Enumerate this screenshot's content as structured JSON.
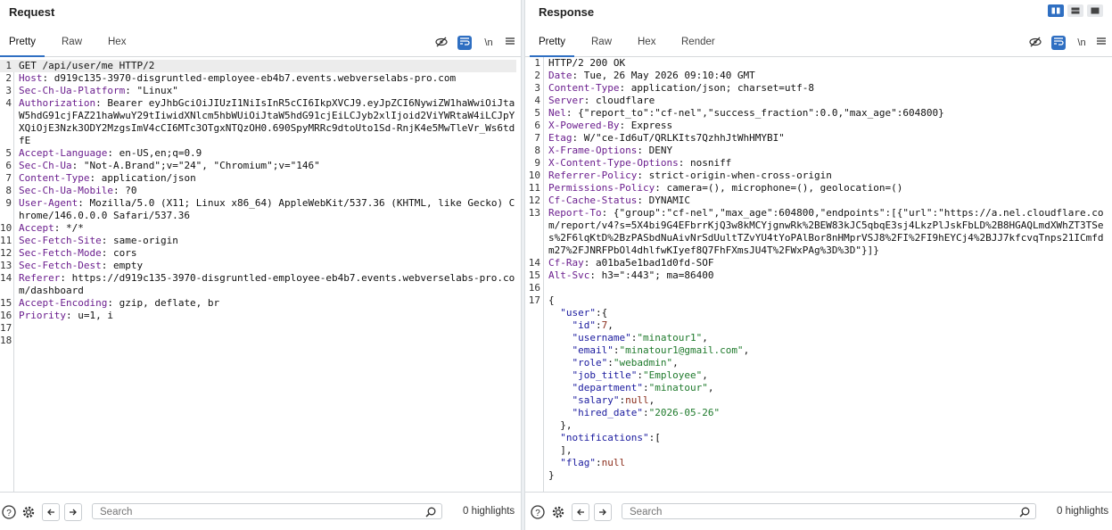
{
  "request": {
    "title": "Request",
    "tabs": [
      "Pretty",
      "Raw",
      "Hex"
    ],
    "active_tab": "Pretty",
    "lines": [
      {
        "n": "1",
        "h": true,
        "k": "",
        "v": "GET /api/user/me HTTP/2"
      },
      {
        "n": "2",
        "k": "Host",
        "v": " d919c135-3970-disgruntled-employee-eb4b7.events.webverselabs-pro.com"
      },
      {
        "n": "3",
        "k": "Sec-Ch-Ua-Platform",
        "v": " \"Linux\""
      },
      {
        "n": "4",
        "k": "Authorization",
        "v": " Bearer eyJhbGciOiJIUzI1NiIsInR5cCI6IkpXVCJ9.eyJpZCI6NywiZW1haWwiOiJtaW5hdG91cjFAZ21haWwuY29tIiwidXNlcm5hbWUiOiJtaW5hdG91cjEiLCJyb2xlIjoid2ViYWRtaW4iLCJpYXQiOjE3Nzk3ODY2MzgsImV4cCI6MTc3OTgxNTQzOH0.690SpyMRRc9dtoUto1Sd-RnjK4e5MwTleVr_Ws6tdfE"
      },
      {
        "n": "5",
        "k": "Accept-Language",
        "v": " en-US,en;q=0.9"
      },
      {
        "n": "6",
        "k": "Sec-Ch-Ua",
        "v": " \"Not-A.Brand\";v=\"24\", \"Chromium\";v=\"146\""
      },
      {
        "n": "7",
        "k": "Content-Type",
        "v": " application/json"
      },
      {
        "n": "8",
        "k": "Sec-Ch-Ua-Mobile",
        "v": " ?0"
      },
      {
        "n": "9",
        "k": "User-Agent",
        "v": " Mozilla/5.0 (X11; Linux x86_64) AppleWebKit/537.36 (KHTML, like Gecko) Chrome/146.0.0.0 Safari/537.36"
      },
      {
        "n": "10",
        "k": "Accept",
        "v": " */*"
      },
      {
        "n": "11",
        "k": "Sec-Fetch-Site",
        "v": " same-origin"
      },
      {
        "n": "12",
        "k": "Sec-Fetch-Mode",
        "v": " cors"
      },
      {
        "n": "13",
        "k": "Sec-Fetch-Dest",
        "v": " empty"
      },
      {
        "n": "14",
        "k": "Referer",
        "v": " https://d919c135-3970-disgruntled-employee-eb4b7.events.webverselabs-pro.com/dashboard"
      },
      {
        "n": "15",
        "k": "Accept-Encoding",
        "v": " gzip, deflate, br"
      },
      {
        "n": "16",
        "k": "Priority",
        "v": " u=1, i"
      },
      {
        "n": "17",
        "k": "",
        "v": ""
      },
      {
        "n": "18",
        "k": "",
        "v": ""
      }
    ],
    "search_placeholder": "Search",
    "highlights": "0 highlights"
  },
  "response": {
    "title": "Response",
    "tabs": [
      "Pretty",
      "Raw",
      "Hex",
      "Render"
    ],
    "active_tab": "Pretty",
    "lines": [
      {
        "n": "1",
        "k": "",
        "v": "HTTP/2 200 OK"
      },
      {
        "n": "2",
        "k": "Date",
        "v": " Tue, 26 May 2026 09:10:40 GMT"
      },
      {
        "n": "3",
        "k": "Content-Type",
        "v": " application/json; charset=utf-8"
      },
      {
        "n": "4",
        "k": "Server",
        "v": " cloudflare"
      },
      {
        "n": "5",
        "k": "Nel",
        "v": " {\"report_to\":\"cf-nel\",\"success_fraction\":0.0,\"max_age\":604800}"
      },
      {
        "n": "6",
        "k": "X-Powered-By",
        "v": " Express"
      },
      {
        "n": "7",
        "k": "Etag",
        "v": " W/\"ce-Id6uT/QRLKIts7QzhhJtWhHMYBI\""
      },
      {
        "n": "8",
        "k": "X-Frame-Options",
        "v": " DENY"
      },
      {
        "n": "9",
        "k": "X-Content-Type-Options",
        "v": " nosniff"
      },
      {
        "n": "10",
        "k": "Referrer-Policy",
        "v": " strict-origin-when-cross-origin"
      },
      {
        "n": "11",
        "k": "Permissions-Policy",
        "v": " camera=(), microphone=(), geolocation=()"
      },
      {
        "n": "12",
        "k": "Cf-Cache-Status",
        "v": " DYNAMIC"
      },
      {
        "n": "13",
        "k": "Report-To",
        "v": " {\"group\":\"cf-nel\",\"max_age\":604800,\"endpoints\":[{\"url\":\"https://a.nel.cloudflare.com/report/v4?s=5X4bi9G4EFbrrKjQ3w8kMCYjgnwRk%2BEW83kJC5qbqE3sj4LkzPlJskFbLD%2B8HGAQLmdXWhZT3TSes%2F6lqKtD%2BzPASbdNuAivNrSdUultTZvYU4tYoPAlBor8nHMprVSJ8%2FI%2FI9hEYCj4%2BJJ7kfcvqTnps21ICmfdm27%2FJNRFPbOl4dhlfwKIyef8Q7FhFXmsJU4T%2FWxPAg%3D%3D\"}]}"
      },
      {
        "n": "14",
        "k": "Cf-Ray",
        "v": " a01ba5e1bad1d0fd-SOF"
      },
      {
        "n": "15",
        "k": "Alt-Svc",
        "v": " h3=\":443\"; ma=86400"
      },
      {
        "n": "16",
        "k": "",
        "v": ""
      }
    ],
    "json_line_number": "17",
    "json": {
      "open": "{",
      "user_key": "\"user\"",
      "fields": [
        {
          "k": "\"id\"",
          "v": "7",
          "t": "n"
        },
        {
          "k": "\"username\"",
          "v": "\"minatour1\"",
          "t": "s"
        },
        {
          "k": "\"email\"",
          "v": "\"minatour1@gmail.com\"",
          "t": "s"
        },
        {
          "k": "\"role\"",
          "v": "\"webadmin\"",
          "t": "s"
        },
        {
          "k": "\"job_title\"",
          "v": "\"Employee\"",
          "t": "s"
        },
        {
          "k": "\"department\"",
          "v": "\"minatour\"",
          "t": "s"
        },
        {
          "k": "\"salary\"",
          "v": "null",
          "t": "n"
        },
        {
          "k": "\"hired_date\"",
          "v": "\"2026-05-26\"",
          "t": "s"
        }
      ],
      "user_close": "},",
      "notifications_key": "\"notifications\"",
      "notifications_close": "],",
      "flag_key": "\"flag\"",
      "flag_value": "null",
      "close": "}"
    },
    "search_placeholder": "Search",
    "highlights": "0 highlights"
  },
  "toolbar_glyphs": {
    "newline": "\\n"
  },
  "accent": "#2f6fc2"
}
